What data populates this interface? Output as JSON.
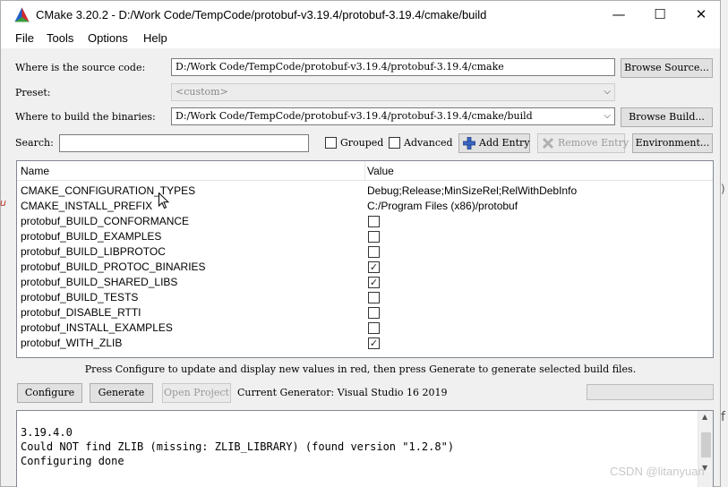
{
  "window": {
    "title": "CMake 3.20.2 - D:/Work Code/TempCode/protobuf-v3.19.4/protobuf-3.19.4/cmake/build",
    "icon": "cmake-triangle-icon",
    "minimize": "—",
    "maximize": "☐",
    "close": "✕"
  },
  "menu": [
    "File",
    "Tools",
    "Options",
    "Help"
  ],
  "source": {
    "label": "Where is the source code:",
    "value": "D:/Work Code/TempCode/protobuf-v3.19.4/protobuf-3.19.4/cmake",
    "browse": "Browse Source..."
  },
  "preset": {
    "label": "Preset:",
    "value": "<custom>"
  },
  "build": {
    "label": "Where to build the binaries:",
    "value": "D:/Work Code/TempCode/protobuf-v3.19.4/protobuf-3.19.4/cmake/build",
    "browse": "Browse Build..."
  },
  "search": {
    "label": "Search:",
    "value": "",
    "grouped": "Grouped",
    "grouped_checked": false,
    "advanced": "Advanced",
    "advanced_checked": false,
    "add_entry": "Add Entry",
    "remove_entry": "Remove Entry",
    "environment": "Environment..."
  },
  "table": {
    "columns": [
      "Name",
      "Value"
    ],
    "rows": [
      {
        "name": "CMAKE_CONFIGURATION_TYPES",
        "value": "Debug;Release;MinSizeRel;RelWithDebInfo",
        "type": "text"
      },
      {
        "name": "CMAKE_INSTALL_PREFIX",
        "value": "C:/Program Files (x86)/protobuf",
        "type": "text"
      },
      {
        "name": "protobuf_BUILD_CONFORMANCE",
        "value": false,
        "type": "bool"
      },
      {
        "name": "protobuf_BUILD_EXAMPLES",
        "value": false,
        "type": "bool"
      },
      {
        "name": "protobuf_BUILD_LIBPROTOC",
        "value": false,
        "type": "bool"
      },
      {
        "name": "protobuf_BUILD_PROTOC_BINARIES",
        "value": true,
        "type": "bool"
      },
      {
        "name": "protobuf_BUILD_SHARED_LIBS",
        "value": true,
        "type": "bool"
      },
      {
        "name": "protobuf_BUILD_TESTS",
        "value": false,
        "type": "bool"
      },
      {
        "name": "protobuf_DISABLE_RTTI",
        "value": false,
        "type": "bool"
      },
      {
        "name": "protobuf_INSTALL_EXAMPLES",
        "value": false,
        "type": "bool"
      },
      {
        "name": "protobuf_WITH_ZLIB",
        "value": true,
        "type": "bool"
      }
    ]
  },
  "hint": "Press Configure to update and display new values in red, then press Generate to generate selected build files.",
  "actions": {
    "configure": "Configure",
    "generate": "Generate",
    "open_project": "Open Project",
    "current_generator": "Current Generator: Visual Studio 16 2019"
  },
  "output": [
    "3.19.4.0",
    "Could NOT find ZLIB (missing: ZLIB_LIBRARY) (found version \"1.2.8\")",
    "Configuring done"
  ],
  "watermark": "CSDN @litanyuan",
  "background": {
    "right_mark_1": ")",
    "right_mark_2": "f",
    "left_mark": "u"
  }
}
